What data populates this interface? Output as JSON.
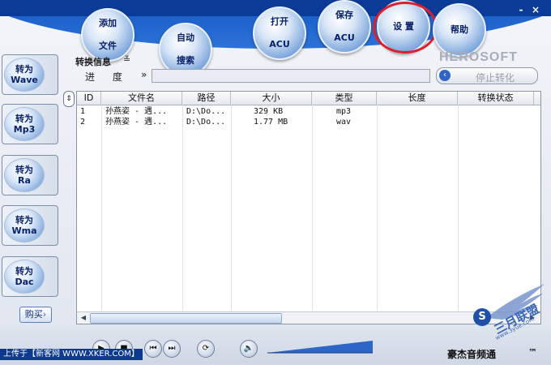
{
  "window": {
    "minimize_label": "-",
    "close_label": "×",
    "brand": "HEROSOFT",
    "app_title": "豪杰音频通",
    "tm": "™"
  },
  "toolbar": {
    "add_file": [
      "添加",
      "文件"
    ],
    "auto_search": [
      "自动",
      "搜索"
    ],
    "open_acu": [
      "打开",
      "ACU"
    ],
    "save_acu": [
      "保存",
      "ACU"
    ],
    "settings": "设 置",
    "help": "帮助"
  },
  "side_buttons": [
    {
      "top": "转为",
      "bottom": "Wave"
    },
    {
      "top": "转为",
      "bottom": "Mp3"
    },
    {
      "top": "转为",
      "bottom": "Ra"
    },
    {
      "top": "转为",
      "bottom": "Wma"
    },
    {
      "top": "转为",
      "bottom": "Dac"
    }
  ],
  "buy_label": "购买",
  "conversion": {
    "info_label": "转换信息",
    "toggle": "≚",
    "progress_label": "进 度",
    "progress_arrow": "»",
    "stop_button": "停止转化",
    "progress_fraction": 0.0
  },
  "table": {
    "columns": [
      "ID",
      "文件名",
      "路径",
      "大小",
      "类型",
      "长度",
      "转换状态"
    ],
    "rows": [
      {
        "id": "1",
        "name": "孙燕姿 - 遇...",
        "path": "D:\\Do...",
        "size": "329 KB",
        "type": "mp3",
        "length": "",
        "status": ""
      },
      {
        "id": "2",
        "name": "孙燕姿 - 遇...",
        "path": "D:\\Do...",
        "size": "1.77 MB",
        "type": "wav",
        "length": "",
        "status": ""
      }
    ]
  },
  "credit": "上传于【新客网 WWW.XKER.COM】",
  "watermark": {
    "seal": "S",
    "text": "三月联盟",
    "sub": "www.3yue.com"
  },
  "colors": {
    "title_bar": "#0a3b96",
    "accent": "#2e66c8",
    "highlight_ring": "#e01f2a"
  }
}
